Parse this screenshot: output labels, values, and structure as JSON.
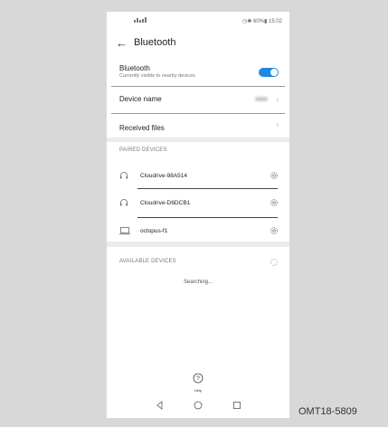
{
  "status_bar": {
    "right_text": "◷✱ 60%▮ 15:02"
  },
  "header": {
    "back_icon": "arrow-left-icon",
    "title": "Bluetooth"
  },
  "bluetooth": {
    "label": "Bluetooth",
    "sub": "Currently visible to nearby devices",
    "enabled": true,
    "accent": "#1e88e5"
  },
  "device_name": {
    "label": "Device name"
  },
  "received_files": {
    "label": "Received files"
  },
  "paired": {
    "heading": "PAIRED DEVICES",
    "devices": [
      {
        "name": "Cloudrive-98A514",
        "icon": "headset-icon"
      },
      {
        "name": "Cloudrive-D6DCB1",
        "icon": "headset-icon"
      },
      {
        "name": "octopus-f1",
        "icon": "laptop-icon"
      }
    ]
  },
  "available": {
    "heading": "AVAILABLE DEVICES",
    "status": "Searching..."
  },
  "help": {
    "label": "Help"
  },
  "caption": "OMT18-5809"
}
